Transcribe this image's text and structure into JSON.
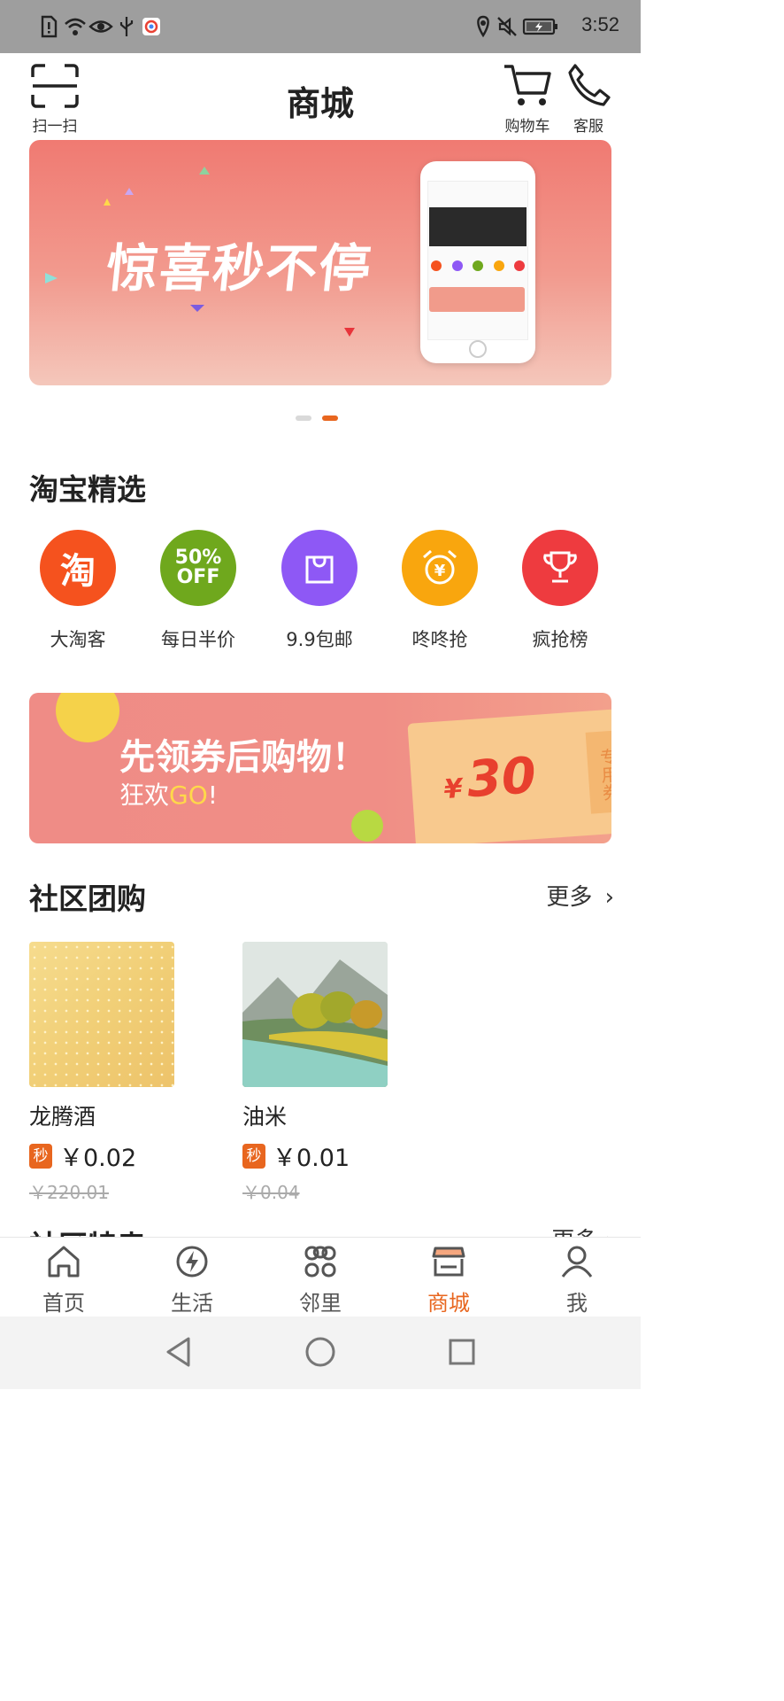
{
  "status_bar": {
    "time": "3:52"
  },
  "header": {
    "title": "商城",
    "scan_label": "扫一扫",
    "cart_label": "购物车",
    "service_label": "客服"
  },
  "banner": {
    "headline": "惊喜秒不停",
    "page_count": 2,
    "active_page": 2
  },
  "taobao_section": {
    "title": "淘宝精选",
    "items": [
      {
        "label": "大淘客",
        "icon": "taobao-icon",
        "color": "#f5521e",
        "glyph": "淘"
      },
      {
        "label": "每日半价",
        "icon": "half-off-icon",
        "color": "#6fa81d",
        "glyph": "50% OFF"
      },
      {
        "label": "9.9包邮",
        "icon": "shopping-bag-icon",
        "color": "#8e58f5"
      },
      {
        "label": "咚咚抢",
        "icon": "alarm-clock-icon",
        "color": "#f9a60e"
      },
      {
        "label": "疯抢榜",
        "icon": "trophy-icon",
        "color": "#ee3b3f"
      }
    ]
  },
  "coupon_banner": {
    "headline": "先领券后购物！",
    "sub_prefix": "狂欢",
    "sub_highlight": "GO",
    "sub_suffix": "!",
    "currency": "¥",
    "amount": "30",
    "stub_text": "专用券"
  },
  "group_buy": {
    "title": "社区团购",
    "more_label": "更多",
    "items": [
      {
        "name": "龙腾酒",
        "badge": "秒",
        "price": "￥0.02",
        "original_price": "￥220.01"
      },
      {
        "name": "油米",
        "badge": "秒",
        "price": "￥0.01",
        "original_price": "￥0.04"
      }
    ]
  },
  "next_section": {
    "title": "社区特卖",
    "more_label": "更多"
  },
  "bottom_nav": {
    "items": [
      {
        "label": "首页",
        "icon": "home-icon"
      },
      {
        "label": "生活",
        "icon": "lightning-icon"
      },
      {
        "label": "邻里",
        "icon": "neighbors-icon"
      },
      {
        "label": "商城",
        "icon": "store-icon",
        "active": true
      },
      {
        "label": "我",
        "icon": "user-icon"
      }
    ]
  },
  "colors": {
    "accent": "#e8661f",
    "inactive_nav": "#555555"
  }
}
